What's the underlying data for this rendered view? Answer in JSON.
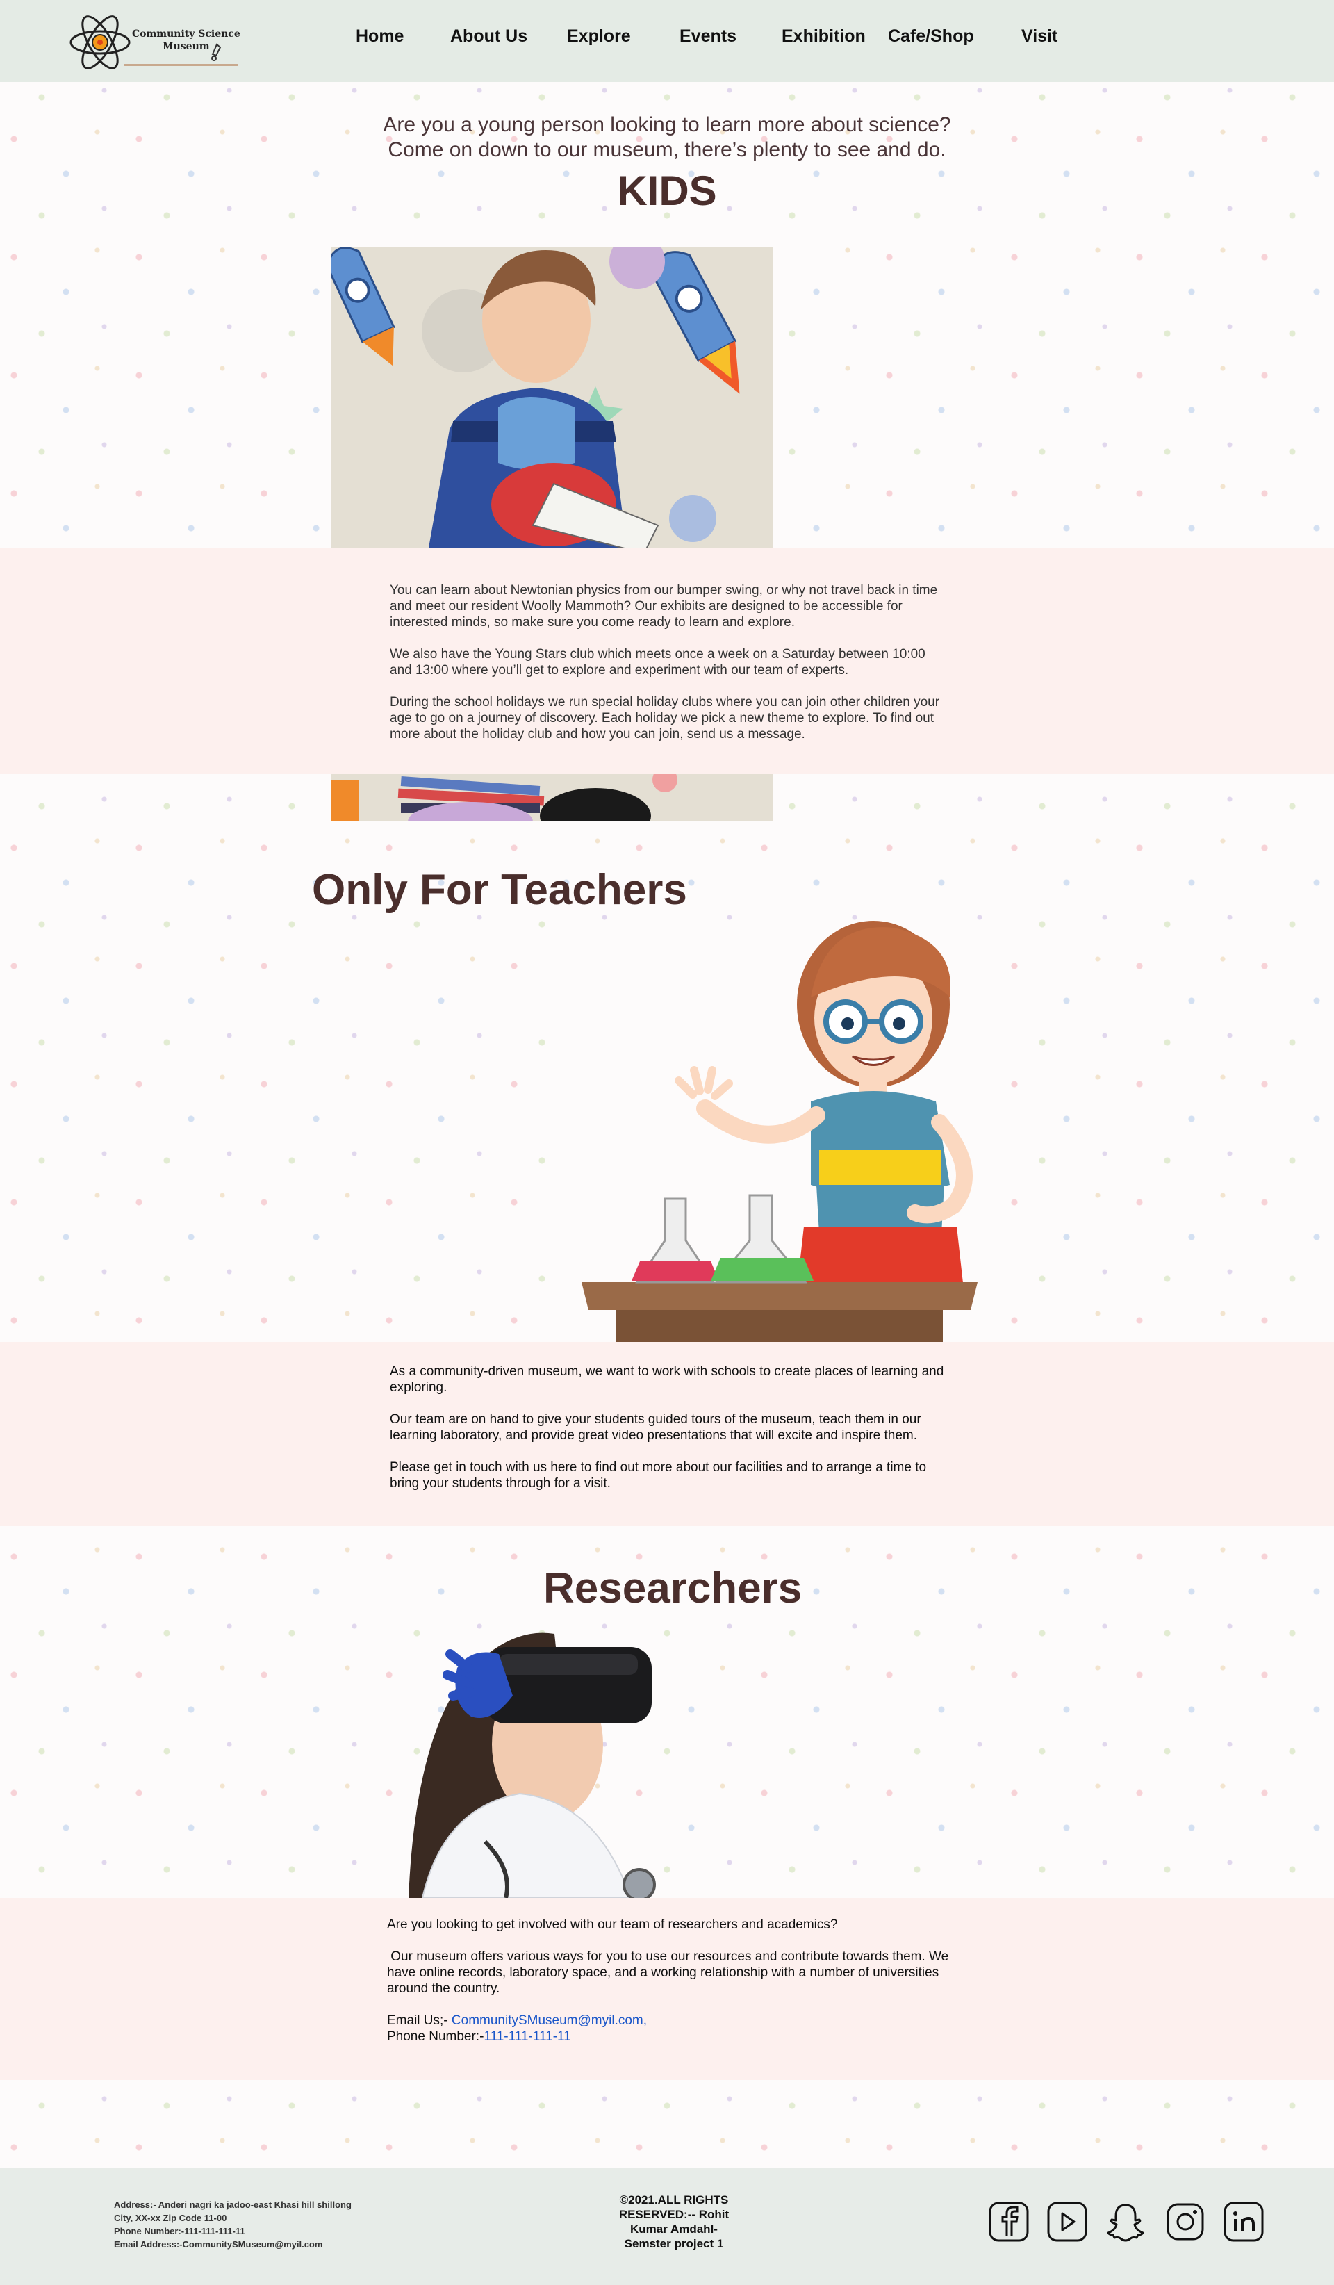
{
  "header": {
    "logo_text_line1": "Community Science",
    "logo_text_line2": "Museum",
    "nav": [
      "Home",
      "About  Us",
      "Explore",
      "Events",
      "Exhibition",
      "Cafe/Shop",
      "Visit"
    ]
  },
  "kids": {
    "intro_line1": "Are you a young person looking to learn more about science?",
    "intro_line2": "Come on down to our museum, there’s plenty to see and do.",
    "heading": "KIDS",
    "paragraphs": [
      "You can learn about Newtonian physics from our bumper swing, or why not travel back in time and meet our resident Woolly Mammoth? Our exhibits are designed to be accessible for interested minds, so make sure you come ready to learn and explore.",
      "We also have the Young Stars club which meets once a week on a Saturday between 10:00 and 13:00 where you’ll get to explore and experiment with our team of experts.",
      "During the school holidays we run special holiday clubs where you can join other children your age to go on a journey of discovery. Each holiday we pick a new theme to explore. To find out more about the holiday club and how you can join, send us a message."
    ]
  },
  "teachers": {
    "heading": "Only For Teachers",
    "paragraphs": [
      "As a community-driven museum, we want to work with schools to create places of learning and exploring.",
      "Our team are on hand to give your students guided tours of the museum, teach them in our learning laboratory, and provide great video presentations that will excite and inspire them.",
      "Please get in touch with us here to find out more about our facilities and to arrange a time to bring your students through for a visit."
    ]
  },
  "researchers": {
    "heading": "Researchers",
    "paragraphs": [
      "Are you looking to get involved with our team of researchers and academics?",
      " Our museum offers various ways for you to use our resources and contribute towards them. We have online records, laboratory space, and a working relationship with a number of universities around the country."
    ],
    "email_label": "Email Us;- ",
    "email": "CommunitySMuseum@myil.com,",
    "phone_label": "Phone Number:-",
    "phone": "111-111-111-11"
  },
  "footer": {
    "address_lines": [
      "Address:- Anderi nagri ka jadoo-east Khasi hill shillong",
      "City, XX-xx Zip Code 11-00",
      "Phone Number:-111-111-111-11",
      "Email Address:-CommunitySMuseum@myil.com"
    ],
    "copyright_lines": [
      "©2021.ALL RIGHTS",
      "RESERVED:-- Rohit",
      "Kumar Amdahl-",
      "Semster project 1"
    ],
    "social_icons": [
      "facebook-icon",
      "youtube-icon",
      "snapchat-icon",
      "instagram-icon",
      "linkedin-icon"
    ]
  },
  "colors": {
    "header_bg": "#e4ebe5",
    "band_bg": "#fdf0ee",
    "heading": "#4a2e2c",
    "link": "#1a56c9"
  }
}
